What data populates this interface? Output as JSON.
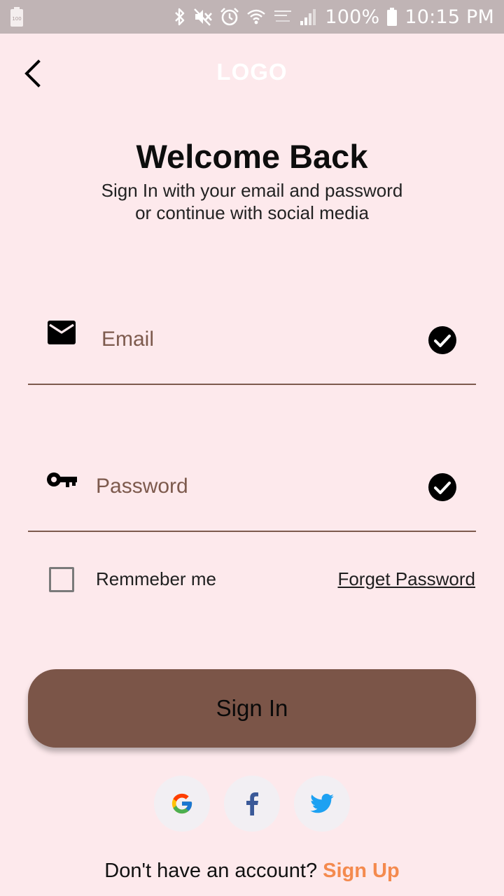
{
  "status_bar": {
    "battery_percent": "100%",
    "time": "10:15 PM",
    "icons": [
      "battery-small-icon",
      "bluetooth-icon",
      "mute-icon",
      "alarm-icon",
      "wifi-icon",
      "network-icon",
      "signal-icon",
      "battery-icon"
    ]
  },
  "header": {
    "logo": "LOGO",
    "back_icon": "chevron-left-icon"
  },
  "welcome": {
    "title": "Welcome Back",
    "subtitle_line1": "Sign In with your email and password",
    "subtitle_line2": "or continue with social media"
  },
  "form": {
    "email": {
      "placeholder": "Email",
      "value": "",
      "icon": "mail-icon",
      "status_icon": "check-circle-icon"
    },
    "password": {
      "placeholder": "Password",
      "value": "",
      "icon": "key-icon",
      "status_icon": "check-circle-icon"
    },
    "remember_label": "Remmeber me",
    "remember_checked": false,
    "forget_password": "Forget Password",
    "submit_label": "Sign In"
  },
  "social": [
    {
      "name": "google",
      "icon": "google-icon"
    },
    {
      "name": "facebook",
      "icon": "facebook-icon"
    },
    {
      "name": "twitter",
      "icon": "twitter-icon"
    }
  ],
  "footer": {
    "prompt": "Don't have an account?",
    "signup_link": "Sign Up"
  },
  "colors": {
    "background": "#fde9ec",
    "status_bar": "#c0b4b5",
    "primary": "#7b5548",
    "accent": "#f48a4e",
    "social_bg": "#f2eff3"
  }
}
